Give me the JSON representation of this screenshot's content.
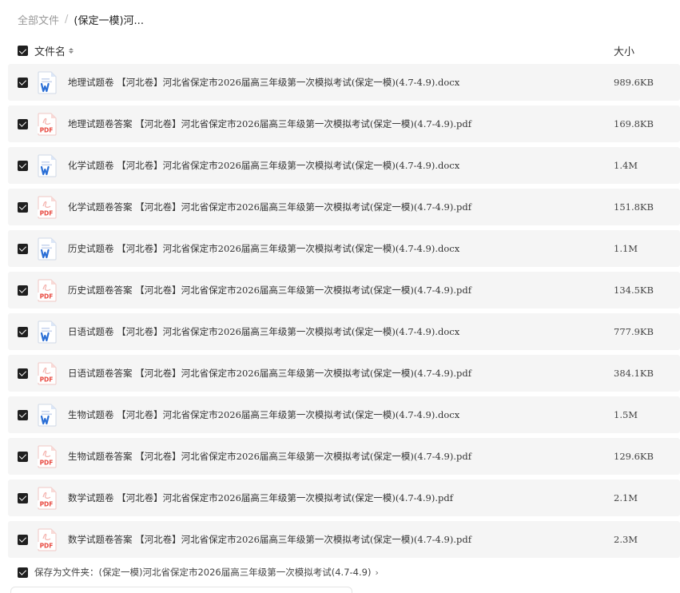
{
  "breadcrumb": {
    "root": "全部文件",
    "separator": "/",
    "current": "(保定一模)河..."
  },
  "table_header": {
    "name": "文件名",
    "size": "大小"
  },
  "files": [
    {
      "name": "地理试题卷 【河北卷】河北省保定市2026届高三年级第一次模拟考试(保定一模)(4.7-4.9).docx",
      "size": "989.6KB",
      "type": "word"
    },
    {
      "name": "地理试题卷答案 【河北卷】河北省保定市2026届高三年级第一次模拟考试(保定一模)(4.7-4.9).pdf",
      "size": "169.8KB",
      "type": "pdf"
    },
    {
      "name": "化学试题卷 【河北卷】河北省保定市2026届高三年级第一次模拟考试(保定一模)(4.7-4.9).docx",
      "size": "1.4M",
      "type": "word"
    },
    {
      "name": "化学试题卷答案 【河北卷】河北省保定市2026届高三年级第一次模拟考试(保定一模)(4.7-4.9).pdf",
      "size": "151.8KB",
      "type": "pdf"
    },
    {
      "name": "历史试题卷 【河北卷】河北省保定市2026届高三年级第一次模拟考试(保定一模)(4.7-4.9).docx",
      "size": "1.1M",
      "type": "word"
    },
    {
      "name": "历史试题卷答案 【河北卷】河北省保定市2026届高三年级第一次模拟考试(保定一模)(4.7-4.9).pdf",
      "size": "134.5KB",
      "type": "pdf"
    },
    {
      "name": "日语试题卷 【河北卷】河北省保定市2026届高三年级第一次模拟考试(保定一模)(4.7-4.9).docx",
      "size": "777.9KB",
      "type": "word"
    },
    {
      "name": "日语试题卷答案 【河北卷】河北省保定市2026届高三年级第一次模拟考试(保定一模)(4.7-4.9).pdf",
      "size": "384.1KB",
      "type": "pdf"
    },
    {
      "name": "生物试题卷 【河北卷】河北省保定市2026届高三年级第一次模拟考试(保定一模)(4.7-4.9).docx",
      "size": "1.5M",
      "type": "word"
    },
    {
      "name": "生物试题卷答案 【河北卷】河北省保定市2026届高三年级第一次模拟考试(保定一模)(4.7-4.9).pdf",
      "size": "129.6KB",
      "type": "pdf"
    },
    {
      "name": "数学试题卷 【河北卷】河北省保定市2026届高三年级第一次模拟考试(保定一模)(4.7-4.9).pdf",
      "size": "2.1M",
      "type": "pdf"
    },
    {
      "name": "数学试题卷答案 【河北卷】河北省保定市2026届高三年级第一次模拟考试(保定一模)(4.7-4.9).pdf",
      "size": "2.3M",
      "type": "pdf"
    }
  ],
  "save_as_folder": {
    "label": "保存为文件夹：(保定一模)河北省保定市2026届高三年级第一次模拟考试(4.7-4.9)",
    "chevron": "›"
  },
  "icons": {
    "word": "word-file-icon",
    "pdf": "pdf-file-icon",
    "checkbox": "checkbox-checked-icon",
    "sort": "sort-icon"
  },
  "colors": {
    "word": "#2b6fd6",
    "pdf": "#e8483f",
    "checkbox": "#1f1f1f",
    "row_bg": "#f5f5f5"
  }
}
